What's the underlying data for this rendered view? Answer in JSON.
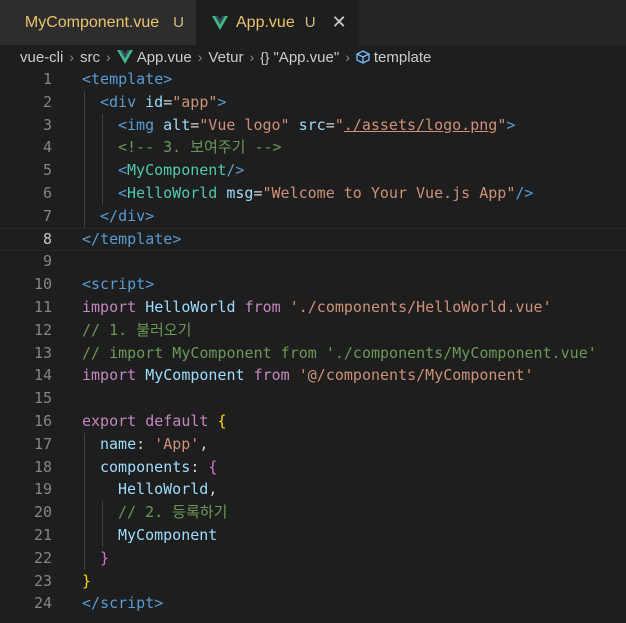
{
  "tabs": [
    {
      "label": "MyComponent.vue",
      "status": "U",
      "active": false
    },
    {
      "label": "App.vue",
      "status": "U",
      "active": true,
      "close": "✕"
    }
  ],
  "breadcrumb": {
    "items": [
      "vue-cli",
      "src",
      "App.vue",
      "Vetur",
      "\"App.vue\"",
      "template"
    ],
    "braces": "{}"
  },
  "code": {
    "line_numbers": [
      "1",
      "2",
      "3",
      "4",
      "5",
      "6",
      "7",
      "8",
      "9",
      "10",
      "11",
      "12",
      "13",
      "14",
      "15",
      "16",
      "17",
      "18",
      "19",
      "20",
      "21",
      "22",
      "23",
      "24"
    ],
    "l1": {
      "open": "<",
      "tag": "template",
      "close": ">"
    },
    "l2": {
      "open": "<",
      "tag": "div",
      "attr": "id",
      "eq": "=",
      "val": "\"app\"",
      "close": ">"
    },
    "l3": {
      "open": "<",
      "tag": "img",
      "attr1": "alt",
      "eq": "=",
      "val1": "\"Vue logo\"",
      "attr2": "src",
      "q1": "\"",
      "link": "./assets/logo.png",
      "q2": "\"",
      "close": ">"
    },
    "l4": {
      "comment": "<!-- 3. 보여주기 -->"
    },
    "l5": {
      "open": "<",
      "comp": "MyComponent",
      "close": "/>"
    },
    "l6": {
      "open": "<",
      "comp": "HelloWorld",
      "attr": "msg",
      "eq": "=",
      "val": "\"Welcome to Your Vue.js App\"",
      "close": "/>"
    },
    "l7": {
      "open": "</",
      "tag": "div",
      "close": ">"
    },
    "l8": {
      "open": "</",
      "tag": "template",
      "close": ">"
    },
    "l10": {
      "open": "<",
      "tag": "script",
      "close": ">"
    },
    "l11": {
      "kw": "import",
      "ident": "HelloWorld",
      "from": "from",
      "str": "'./components/HelloWorld.vue'"
    },
    "l12": {
      "comment": "// 1. 불러오기"
    },
    "l13": {
      "comment": "// import MyComponent from './components/MyComponent.vue'"
    },
    "l14": {
      "kw": "import",
      "ident": "MyComponent",
      "from": "from",
      "str": "'@/components/MyComponent'"
    },
    "l16": {
      "kw": "export",
      "kw2": "default",
      "brace": "{"
    },
    "l17": {
      "ident": "name",
      "colon": ":",
      "str": "'App'",
      "comma": ","
    },
    "l18": {
      "ident": "components",
      "colon": ":",
      "brace": "{"
    },
    "l19": {
      "ident": "HelloWorld",
      "comma": ","
    },
    "l20": {
      "comment": "// 2. 등록하기"
    },
    "l21": {
      "ident": "MyComponent"
    },
    "l22": {
      "brace": "}"
    },
    "l23": {
      "brace": "}"
    },
    "l24": {
      "open": "</",
      "tag": "script",
      "close": ">"
    }
  },
  "colors": {
    "vue_green": "#41b883",
    "vue_dark": "#35495e",
    "modified": "#e9c46a"
  }
}
